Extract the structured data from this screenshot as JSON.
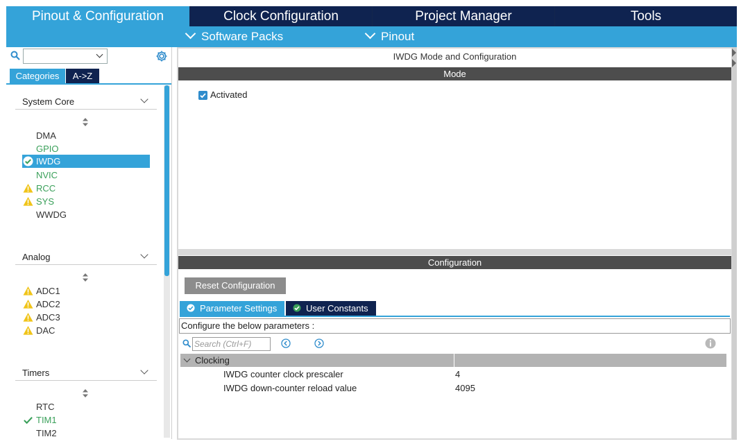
{
  "top_tabs": [
    {
      "label": "Pinout & Configuration"
    },
    {
      "label": "Clock Configuration"
    },
    {
      "label": "Project Manager"
    },
    {
      "label": "Tools"
    }
  ],
  "sub_menu": [
    {
      "label": "Software Packs"
    },
    {
      "label": "Pinout"
    }
  ],
  "left": {
    "category_select_value": "",
    "tabs": {
      "categories": "Categories",
      "az": "A->Z"
    },
    "groups": [
      {
        "label": "System Core",
        "items": [
          {
            "label": "DMA",
            "status": "none"
          },
          {
            "label": "GPIO",
            "status": "configured"
          },
          {
            "label": "IWDG",
            "status": "ok",
            "selected": true
          },
          {
            "label": "NVIC",
            "status": "configured"
          },
          {
            "label": "RCC",
            "status": "warning"
          },
          {
            "label": "SYS",
            "status": "warning"
          },
          {
            "label": "WWDG",
            "status": "none"
          }
        ]
      },
      {
        "label": "Analog",
        "items": [
          {
            "label": "ADC1",
            "status": "warning"
          },
          {
            "label": "ADC2",
            "status": "warning"
          },
          {
            "label": "ADC3",
            "status": "warning"
          },
          {
            "label": "DAC",
            "status": "warning"
          }
        ]
      },
      {
        "label": "Timers",
        "items": [
          {
            "label": "RTC",
            "status": "none"
          },
          {
            "label": "TIM1",
            "status": "checked"
          },
          {
            "label": "TIM2",
            "status": "none"
          }
        ]
      }
    ]
  },
  "main": {
    "title": "IWDG Mode and Configuration",
    "mode_header": "Mode",
    "activated_label": "Activated",
    "activated_checked": true,
    "configuration_header": "Configuration",
    "reset_button": "Reset Configuration",
    "config_tabs": {
      "params": "Parameter Settings",
      "user_constants": "User Constants"
    },
    "params_description": "Configure the below parameters :",
    "search_placeholder": "Search (Ctrl+F)",
    "group": "Clocking",
    "params": [
      {
        "name": "IWDG counter clock prescaler",
        "value": "4"
      },
      {
        "name": "IWDG down-counter reload value",
        "value": "4095"
      }
    ]
  },
  "colors": {
    "accent_blue": "#34a3d9",
    "navy": "#0f2350",
    "ok_green": "#3aa05a",
    "warning_yellow": "#f0c419",
    "dark_bar": "#4d4d4d"
  }
}
